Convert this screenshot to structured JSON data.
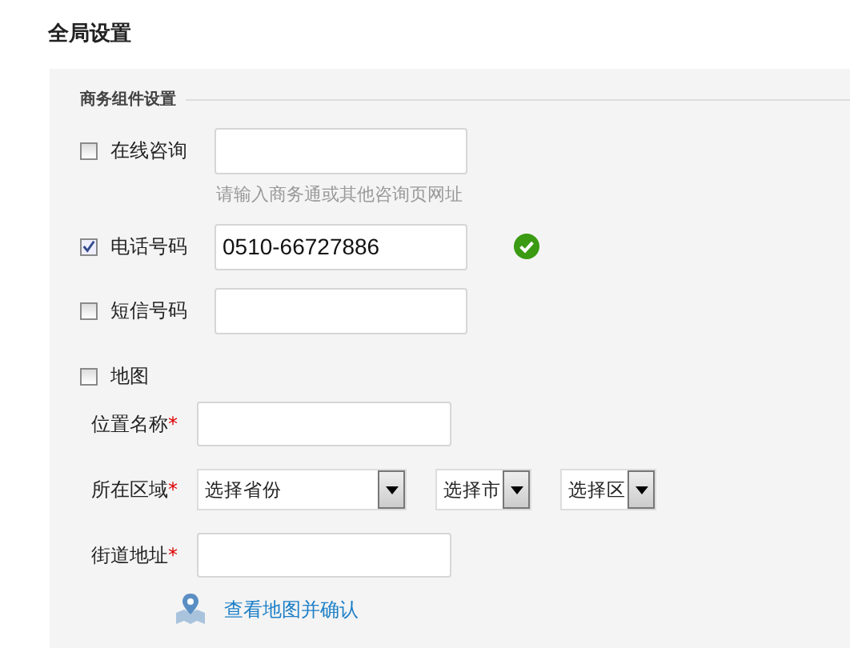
{
  "title": "全局设置",
  "section": {
    "title": "商务组件设置"
  },
  "components": [
    {
      "kind": "field",
      "label": "在线咨询",
      "checked": false,
      "hint": "请输入商务通或其他咨询页网址",
      "valid": false
    },
    {
      "kind": "field",
      "label": "电话号码",
      "checked": true,
      "value": "0510-66727886",
      "valid": true
    },
    {
      "kind": "field",
      "label": "短信号码",
      "checked": false,
      "valid": false
    },
    {
      "kind": "map",
      "label": "地图",
      "checked": false
    }
  ],
  "map_fields": [
    {
      "kind": "input",
      "label": "位置名称",
      "mark": "*"
    },
    {
      "kind": "selects",
      "label": "所在区域",
      "mark": "*",
      "selects": [
        {
          "text": "选择省份"
        },
        {
          "text": "选择市"
        },
        {
          "text": "选择区"
        }
      ]
    },
    {
      "kind": "input",
      "label": "街道地址",
      "mark": "*"
    }
  ],
  "map_link": "查看地图并确认"
}
